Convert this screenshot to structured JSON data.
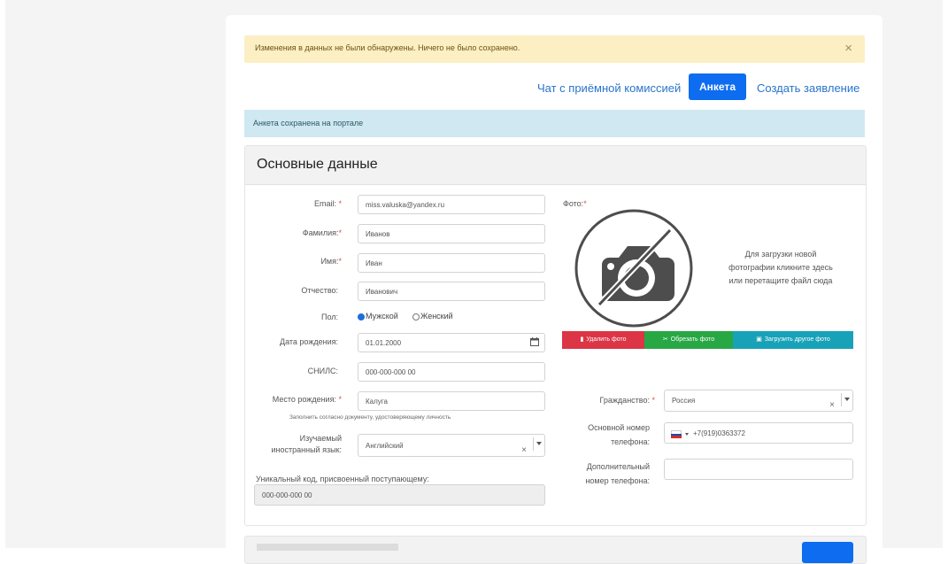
{
  "alert_warning": {
    "text": "Изменения в данных не были обнаружены. Ничего не было сохранено.",
    "close": "×"
  },
  "nav": {
    "chat": "Чат с приёмной комиссией",
    "anketa": "Анкета",
    "create": "Создать заявление"
  },
  "alert_info": "Анкета сохранена на портале",
  "card": {
    "title": "Основные данные",
    "email": {
      "label": "Email:",
      "value": "miss.valuska@yandex.ru"
    },
    "lastname": {
      "label": "Фамилия:",
      "value": "Иванов"
    },
    "firstname": {
      "label": "Имя:",
      "value": "Иван"
    },
    "patronymic": {
      "label": "Отчество:",
      "value": "Иванович"
    },
    "gender": {
      "label": "Пол:",
      "male": "Мужской",
      "female": "Женский",
      "selected": "male"
    },
    "birthdate": {
      "label": "Дата рождения:",
      "value": "01.01.2000"
    },
    "snils": {
      "label": "СНИЛС:",
      "value": "000-000-000 00"
    },
    "birthplace": {
      "label": "Место рождения:",
      "value": "Калуга",
      "hint": "Заполнить согласно документу, удостоверяющему личность"
    },
    "language": {
      "label_1": "Изучаемый",
      "label_2": "иностранный язык:",
      "value": "Английский"
    },
    "code": {
      "label": "Уникальный код, присвоенный поступающему:",
      "value": "000-000-000 00"
    },
    "photo": {
      "label": "Фото:",
      "desc_1": "Для загрузки новой",
      "desc_2": "фотографии кликните здесь",
      "desc_3": "или перетащите файл сюда",
      "btn_delete": "Удалить фото",
      "btn_crop": "Обрезать фото",
      "btn_upload": "Загрузить другое фото"
    },
    "citizenship": {
      "label": "Гражданство:",
      "value": "Россия"
    },
    "phone_main": {
      "label_1": "Основной номер",
      "label_2": "телефона:",
      "value": "+7(919)0363372"
    },
    "phone_extra": {
      "label_1": "Дополнительный",
      "label_2": "номер телефона:",
      "value": ""
    }
  },
  "icons": [
    "close-icon",
    "calendar-icon",
    "camera-placeholder-icon",
    "trash-icon",
    "scissors-icon",
    "image-icon",
    "russia-flag-icon",
    "chevron-down-icon"
  ],
  "colors": {
    "primary": "#0d6cf0",
    "danger": "#dc3545",
    "success": "#28a745",
    "info": "#17a2b8",
    "warning_bg": "#fcefc3",
    "info_bg": "#cfe8f1"
  }
}
